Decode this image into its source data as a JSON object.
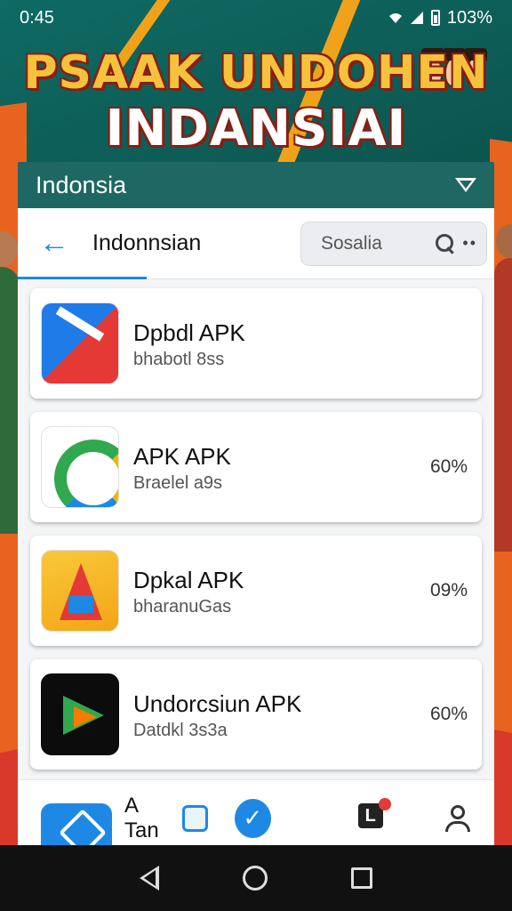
{
  "status_bar": {
    "time": "0:45",
    "battery": "103%"
  },
  "banner": {
    "title": "PSAAK UNDOHEN",
    "subtitle": "INDANSIAI"
  },
  "header": {
    "title": "Indonsia"
  },
  "search_row": {
    "title": "Indonnsian",
    "search_placeholder": "Sosalia"
  },
  "apps": [
    {
      "name": "Dpbdl APK",
      "subtitle": "bhabotl 8ss",
      "percent": "",
      "icon": "red-blue-app-icon"
    },
    {
      "name": "APK APK",
      "subtitle": "Braelel a9s",
      "percent": "60%",
      "icon": "green-circle-app-icon"
    },
    {
      "name": "Dpkal APK",
      "subtitle": "bharanuGas",
      "percent": "09%",
      "icon": "yellow-a-app-icon"
    },
    {
      "name": "Undorcsiun APK",
      "subtitle": "Datdkl 3s3a",
      "percent": "60%",
      "icon": "play-arrow-app-icon"
    }
  ],
  "bottom_nav": {
    "label": "A Tan",
    "l_icon": "L"
  },
  "colors": {
    "accent": "#1a8be0",
    "header_bg": "#1f6763",
    "banner_yellow": "#f7c23b"
  }
}
